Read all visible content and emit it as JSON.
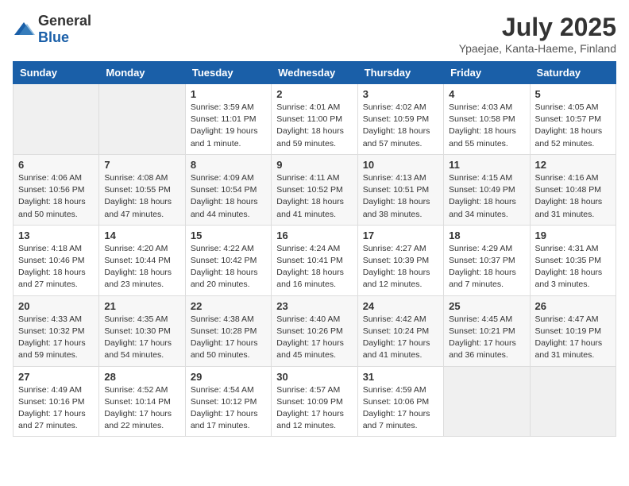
{
  "logo": {
    "general": "General",
    "blue": "Blue"
  },
  "title": {
    "month_year": "July 2025",
    "location": "Ypaejae, Kanta-Haeme, Finland"
  },
  "weekdays": [
    "Sunday",
    "Monday",
    "Tuesday",
    "Wednesday",
    "Thursday",
    "Friday",
    "Saturday"
  ],
  "weeks": [
    [
      {
        "day": "",
        "info": ""
      },
      {
        "day": "",
        "info": ""
      },
      {
        "day": "1",
        "info": "Sunrise: 3:59 AM\nSunset: 11:01 PM\nDaylight: 19 hours\nand 1 minute."
      },
      {
        "day": "2",
        "info": "Sunrise: 4:01 AM\nSunset: 11:00 PM\nDaylight: 18 hours\nand 59 minutes."
      },
      {
        "day": "3",
        "info": "Sunrise: 4:02 AM\nSunset: 10:59 PM\nDaylight: 18 hours\nand 57 minutes."
      },
      {
        "day": "4",
        "info": "Sunrise: 4:03 AM\nSunset: 10:58 PM\nDaylight: 18 hours\nand 55 minutes."
      },
      {
        "day": "5",
        "info": "Sunrise: 4:05 AM\nSunset: 10:57 PM\nDaylight: 18 hours\nand 52 minutes."
      }
    ],
    [
      {
        "day": "6",
        "info": "Sunrise: 4:06 AM\nSunset: 10:56 PM\nDaylight: 18 hours\nand 50 minutes."
      },
      {
        "day": "7",
        "info": "Sunrise: 4:08 AM\nSunset: 10:55 PM\nDaylight: 18 hours\nand 47 minutes."
      },
      {
        "day": "8",
        "info": "Sunrise: 4:09 AM\nSunset: 10:54 PM\nDaylight: 18 hours\nand 44 minutes."
      },
      {
        "day": "9",
        "info": "Sunrise: 4:11 AM\nSunset: 10:52 PM\nDaylight: 18 hours\nand 41 minutes."
      },
      {
        "day": "10",
        "info": "Sunrise: 4:13 AM\nSunset: 10:51 PM\nDaylight: 18 hours\nand 38 minutes."
      },
      {
        "day": "11",
        "info": "Sunrise: 4:15 AM\nSunset: 10:49 PM\nDaylight: 18 hours\nand 34 minutes."
      },
      {
        "day": "12",
        "info": "Sunrise: 4:16 AM\nSunset: 10:48 PM\nDaylight: 18 hours\nand 31 minutes."
      }
    ],
    [
      {
        "day": "13",
        "info": "Sunrise: 4:18 AM\nSunset: 10:46 PM\nDaylight: 18 hours\nand 27 minutes."
      },
      {
        "day": "14",
        "info": "Sunrise: 4:20 AM\nSunset: 10:44 PM\nDaylight: 18 hours\nand 23 minutes."
      },
      {
        "day": "15",
        "info": "Sunrise: 4:22 AM\nSunset: 10:42 PM\nDaylight: 18 hours\nand 20 minutes."
      },
      {
        "day": "16",
        "info": "Sunrise: 4:24 AM\nSunset: 10:41 PM\nDaylight: 18 hours\nand 16 minutes."
      },
      {
        "day": "17",
        "info": "Sunrise: 4:27 AM\nSunset: 10:39 PM\nDaylight: 18 hours\nand 12 minutes."
      },
      {
        "day": "18",
        "info": "Sunrise: 4:29 AM\nSunset: 10:37 PM\nDaylight: 18 hours\nand 7 minutes."
      },
      {
        "day": "19",
        "info": "Sunrise: 4:31 AM\nSunset: 10:35 PM\nDaylight: 18 hours\nand 3 minutes."
      }
    ],
    [
      {
        "day": "20",
        "info": "Sunrise: 4:33 AM\nSunset: 10:32 PM\nDaylight: 17 hours\nand 59 minutes."
      },
      {
        "day": "21",
        "info": "Sunrise: 4:35 AM\nSunset: 10:30 PM\nDaylight: 17 hours\nand 54 minutes."
      },
      {
        "day": "22",
        "info": "Sunrise: 4:38 AM\nSunset: 10:28 PM\nDaylight: 17 hours\nand 50 minutes."
      },
      {
        "day": "23",
        "info": "Sunrise: 4:40 AM\nSunset: 10:26 PM\nDaylight: 17 hours\nand 45 minutes."
      },
      {
        "day": "24",
        "info": "Sunrise: 4:42 AM\nSunset: 10:24 PM\nDaylight: 17 hours\nand 41 minutes."
      },
      {
        "day": "25",
        "info": "Sunrise: 4:45 AM\nSunset: 10:21 PM\nDaylight: 17 hours\nand 36 minutes."
      },
      {
        "day": "26",
        "info": "Sunrise: 4:47 AM\nSunset: 10:19 PM\nDaylight: 17 hours\nand 31 minutes."
      }
    ],
    [
      {
        "day": "27",
        "info": "Sunrise: 4:49 AM\nSunset: 10:16 PM\nDaylight: 17 hours\nand 27 minutes."
      },
      {
        "day": "28",
        "info": "Sunrise: 4:52 AM\nSunset: 10:14 PM\nDaylight: 17 hours\nand 22 minutes."
      },
      {
        "day": "29",
        "info": "Sunrise: 4:54 AM\nSunset: 10:12 PM\nDaylight: 17 hours\nand 17 minutes."
      },
      {
        "day": "30",
        "info": "Sunrise: 4:57 AM\nSunset: 10:09 PM\nDaylight: 17 hours\nand 12 minutes."
      },
      {
        "day": "31",
        "info": "Sunrise: 4:59 AM\nSunset: 10:06 PM\nDaylight: 17 hours\nand 7 minutes."
      },
      {
        "day": "",
        "info": ""
      },
      {
        "day": "",
        "info": ""
      }
    ]
  ]
}
